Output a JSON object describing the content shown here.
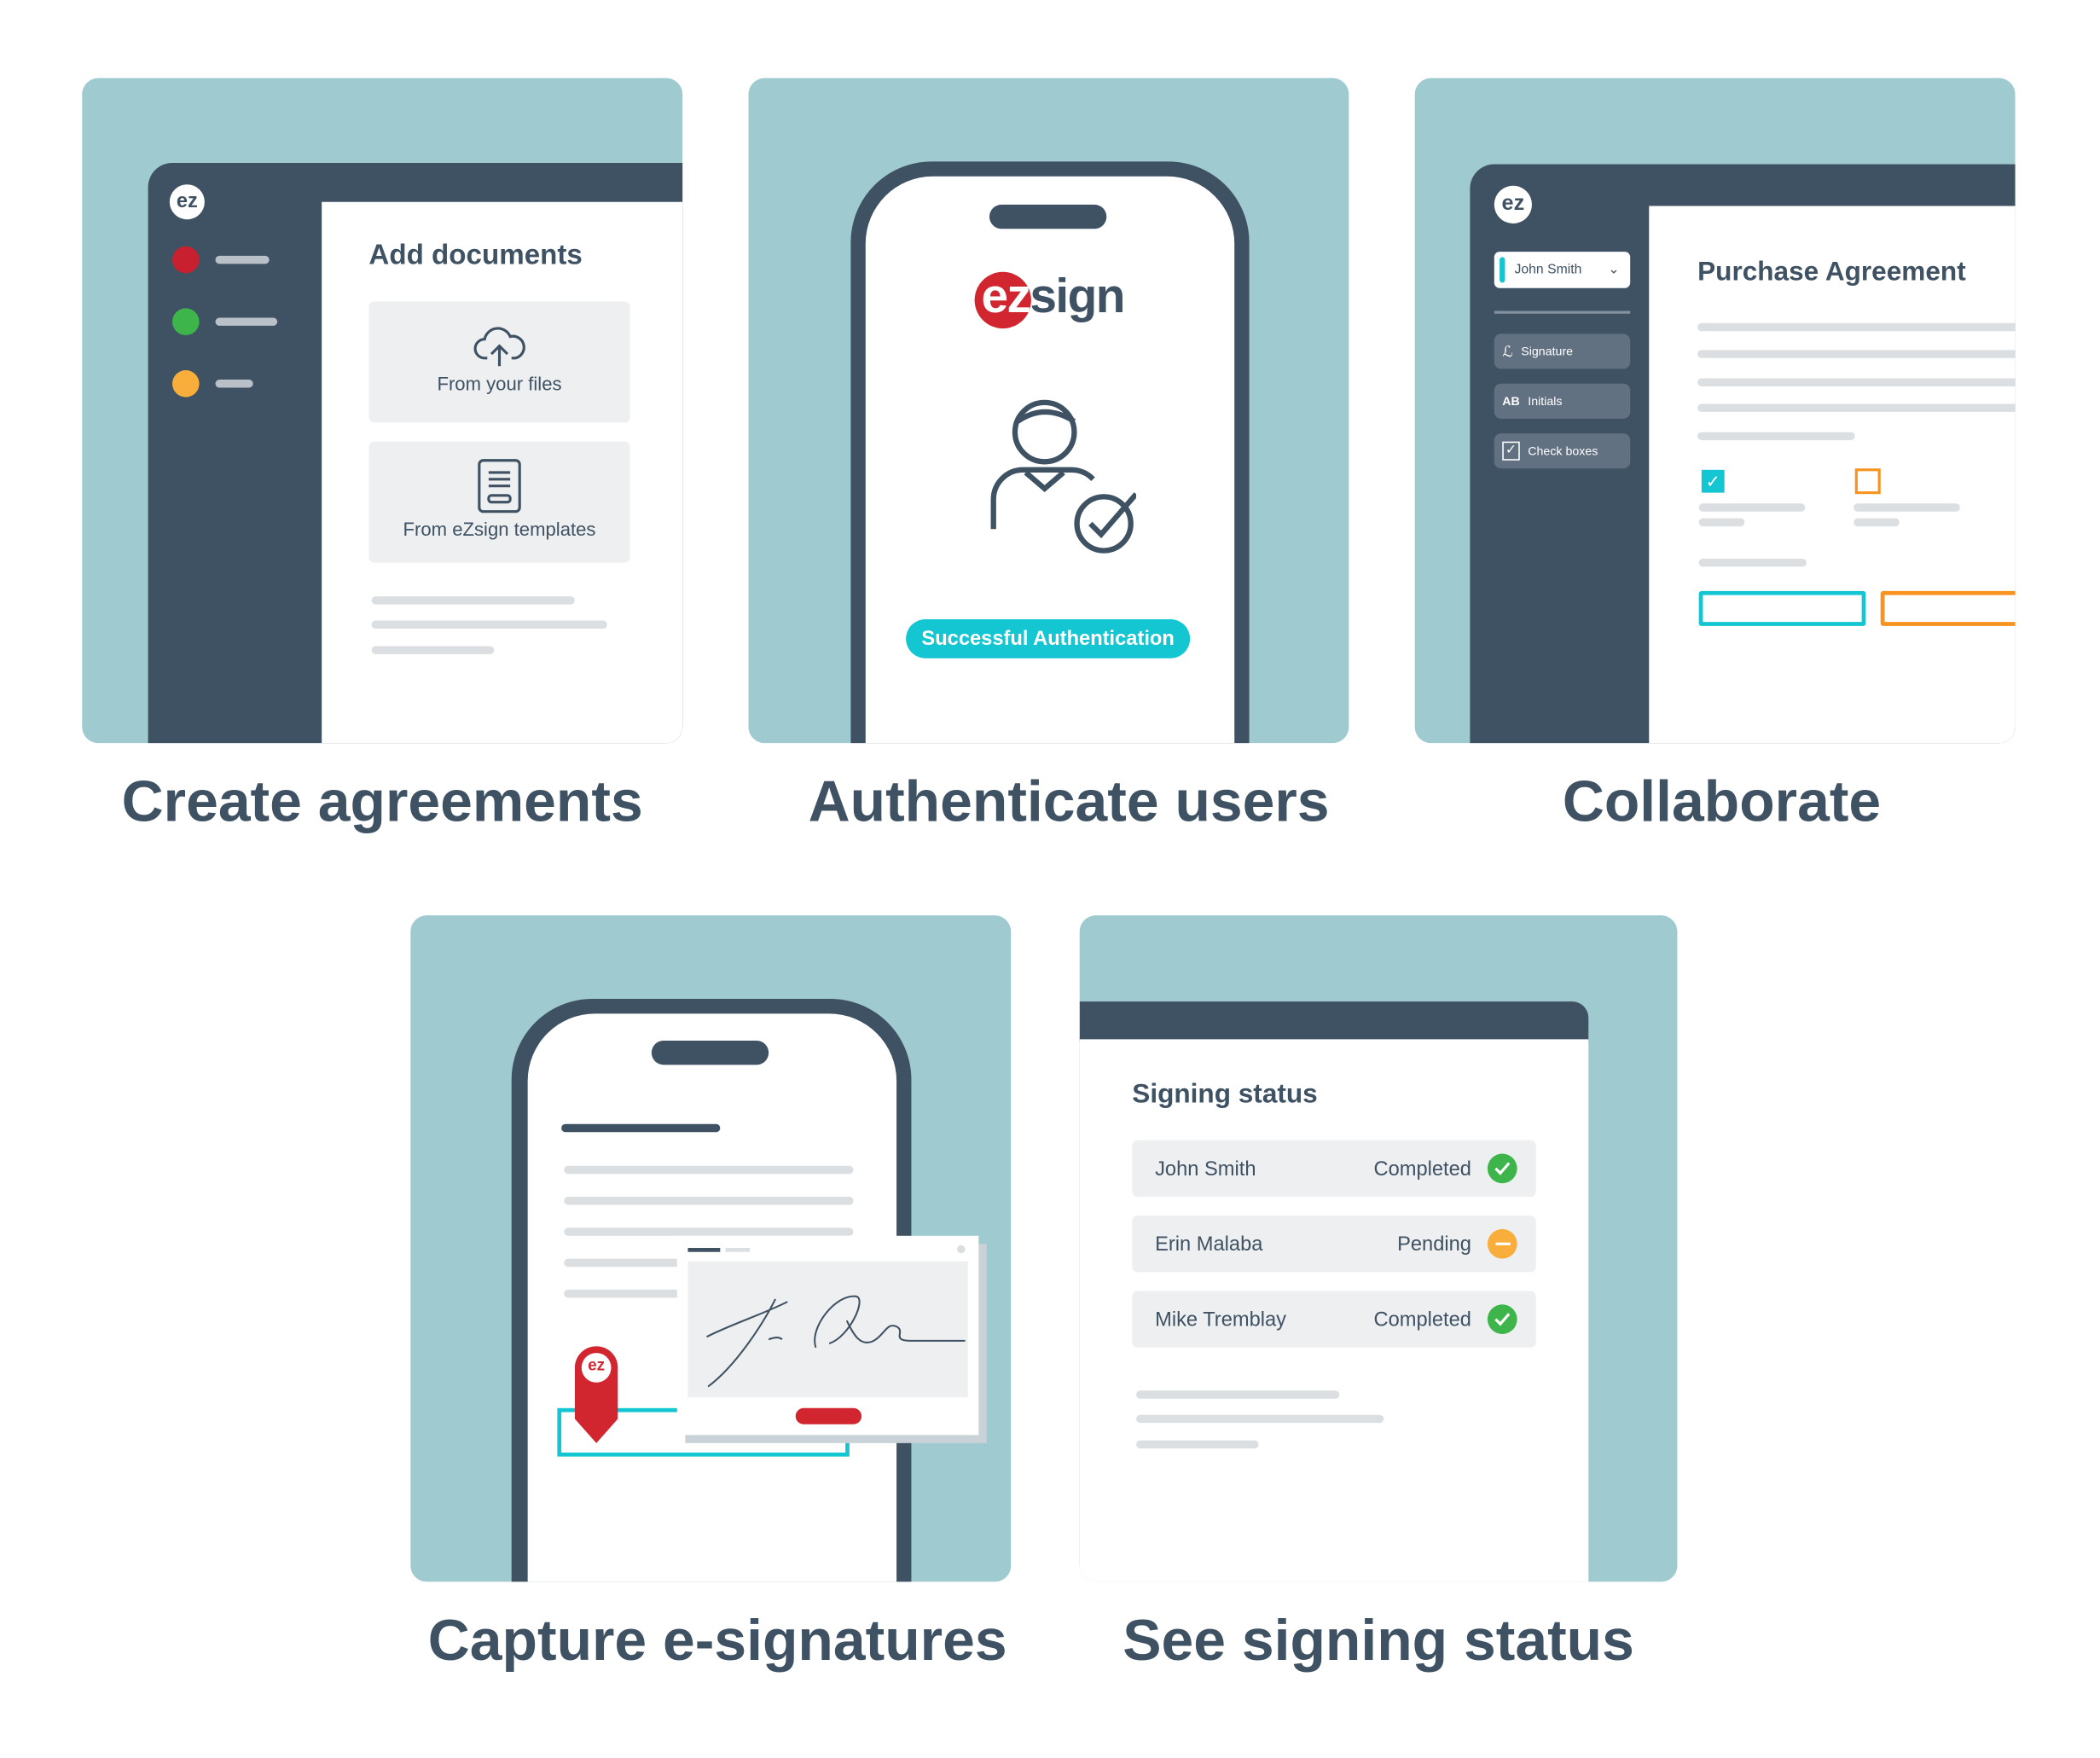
{
  "colors": {
    "teal_bg": "#9fcad0",
    "dark": "#3f5263",
    "accent": "#14c6d1",
    "orange": "#f7931e",
    "red": "#d12630",
    "green": "#3db54a",
    "amber": "#f9ae3b"
  },
  "panels": {
    "create": {
      "caption": "Create agreements",
      "title": "Add documents",
      "logo": "ez",
      "options": [
        {
          "label": "From your files",
          "icon": "cloud-upload-icon"
        },
        {
          "label": "From eZsign templates",
          "icon": "document-template-icon"
        }
      ]
    },
    "authenticate": {
      "caption": "Authenticate users",
      "logo": "ezsign",
      "button": "Successful Authentication",
      "icon": "user-check-icon"
    },
    "collaborate": {
      "caption": "Collaborate",
      "logo": "ez",
      "signer": "John Smith",
      "tools": [
        {
          "label": "Signature",
          "icon": "signature-icon"
        },
        {
          "label": "Initials",
          "icon": "AB"
        },
        {
          "label": "Check boxes",
          "icon": "checkbox-icon"
        }
      ],
      "title": "Purchase Agreement"
    },
    "capture": {
      "caption": "Capture e-signatures",
      "logo": "ez"
    },
    "status": {
      "caption": "See signing status",
      "title": "Signing status",
      "rows": [
        {
          "name": "John Smith",
          "status": "Completed",
          "state": "completed"
        },
        {
          "name": "Erin Malaba",
          "status": "Pending",
          "state": "pending"
        },
        {
          "name": "Mike Tremblay",
          "status": "Completed",
          "state": "completed"
        }
      ]
    }
  }
}
